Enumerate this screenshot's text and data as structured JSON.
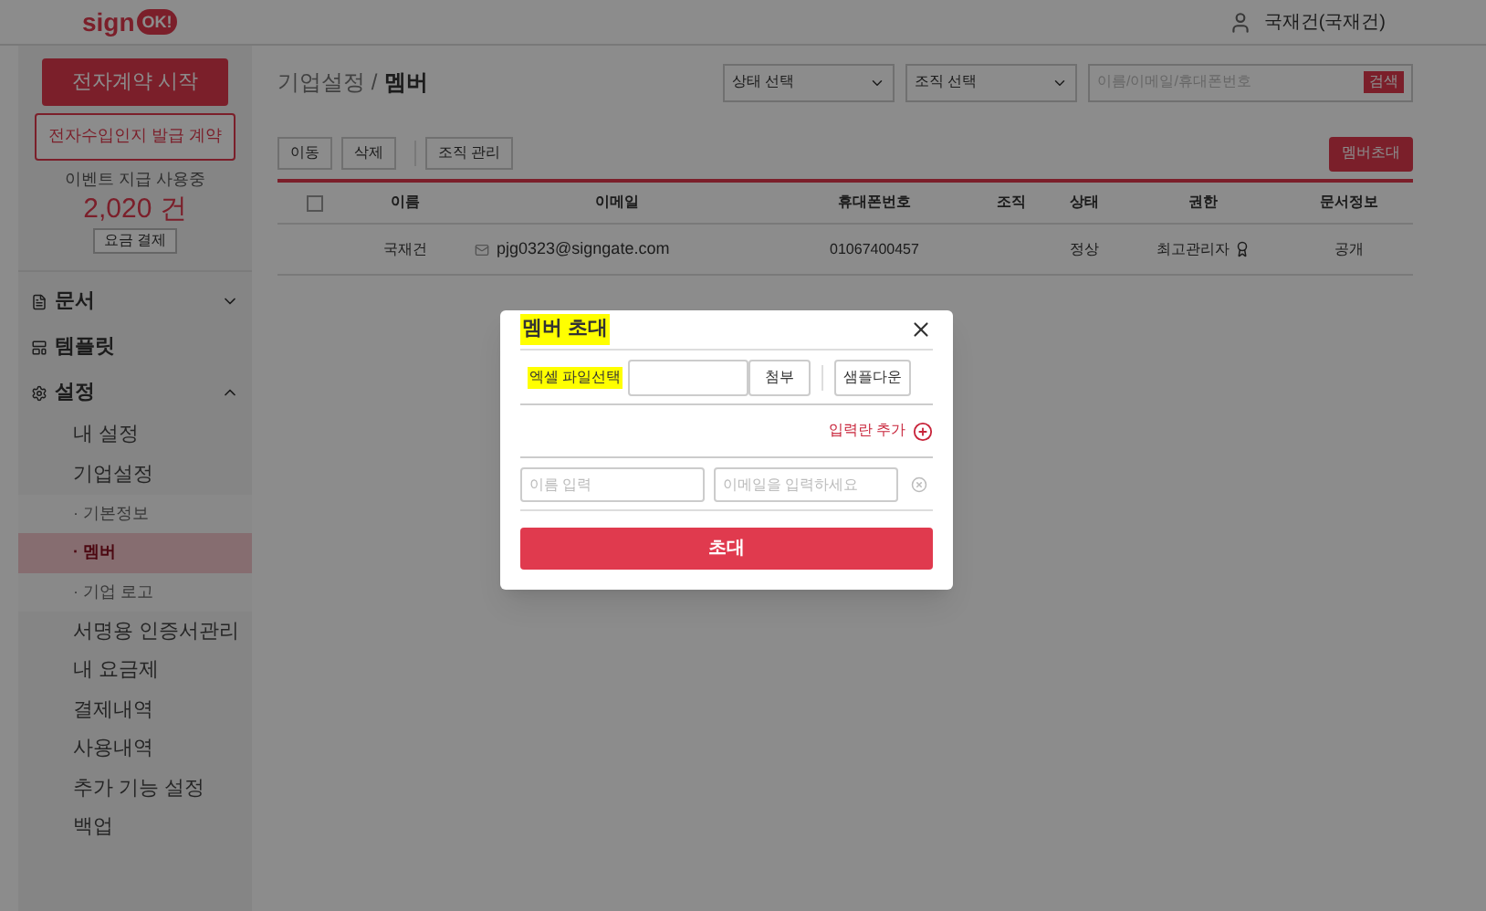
{
  "header": {
    "logo_text": "sign",
    "logo_badge": "OK!",
    "user": "국재건(국재건)"
  },
  "sidebar": {
    "start_button": "전자계약 시작",
    "stamp_button": "전자수입인지 발급 계약",
    "usage_label": "이벤트 지급 사용중",
    "usage_count": "2,020 건",
    "pay_button": "요금 결제",
    "menu": [
      {
        "label": "문서",
        "expanded": false
      },
      {
        "label": "템플릿"
      },
      {
        "label": "설정",
        "expanded": true,
        "children": [
          {
            "label": "내 설정",
            "selected": false
          },
          {
            "label": "기업설정",
            "selected": false,
            "children": [
              {
                "label": "· 기본정보",
                "selected": false
              },
              {
                "label": "· 멤버",
                "selected": true
              },
              {
                "label": "· 기업 로고",
                "selected": false
              }
            ]
          },
          {
            "label": "서명용 인증서관리",
            "selected": false
          },
          {
            "label": "내 요금제",
            "selected": false
          },
          {
            "label": "결제내역",
            "selected": false
          },
          {
            "label": "사용내역",
            "selected": false
          },
          {
            "label": "추가 기능 설정",
            "selected": false
          },
          {
            "label": "백업",
            "selected": false
          }
        ]
      }
    ]
  },
  "main": {
    "breadcrumb_parent": "기업설정 /",
    "breadcrumb_current": "멤버",
    "filters": [
      "상태 선택",
      "조직 선택"
    ],
    "search": {
      "placeholder": "이름/이메일/휴대폰번호",
      "button": "검색"
    },
    "actions": [
      "이동",
      "삭제",
      "조직 관리"
    ],
    "invite_button": "멤버초대",
    "table": {
      "select_all": {
        "checked": false
      },
      "columns": [
        "이름",
        "이메일",
        "휴대폰번호",
        "조직",
        "상태",
        "권한",
        "문서정보"
      ],
      "rows": [
        {
          "name": "국재건",
          "email": "pjg0323@signgate.com",
          "phone": "01067400457",
          "status": "정상",
          "role": "최고관리자",
          "docs": "공개"
        }
      ]
    }
  },
  "modal": {
    "title": "멤버 초대",
    "title_highlighted": true,
    "excel_label": "엑셀 파일선택",
    "excel_label_highlighted": true,
    "attach_button": "첨부",
    "sample_button": "샘플다운",
    "add_row": "입력란 추가",
    "rows": [
      {
        "name_placeholder": "이름 입력",
        "email_placeholder": "이메일을 입력하세요"
      }
    ],
    "submit": "초대"
  }
}
